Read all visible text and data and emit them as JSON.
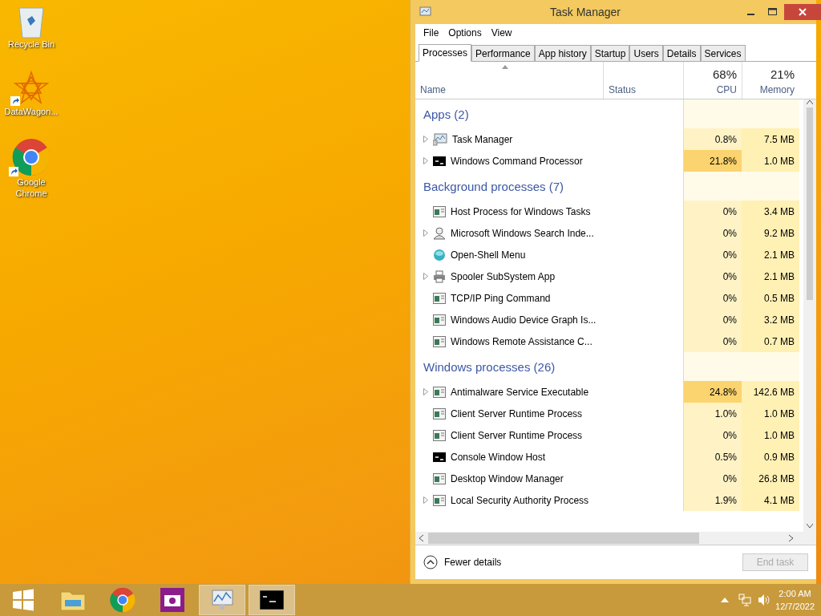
{
  "desktop": {
    "icons": [
      {
        "kind": "recycle",
        "label": "Recycle Bin",
        "shortcut": false
      },
      {
        "kind": "datawagon",
        "label": "DataWagon...",
        "shortcut": true
      },
      {
        "kind": "chrome",
        "label": "Google Chrome",
        "shortcut": true
      }
    ]
  },
  "window": {
    "title": "Task Manager",
    "menu": [
      "File",
      "Options",
      "View"
    ],
    "tabs": [
      {
        "label": "Processes",
        "selected": true
      },
      {
        "label": "Performance",
        "selected": false
      },
      {
        "label": "App history",
        "selected": false
      },
      {
        "label": "Startup",
        "selected": false
      },
      {
        "label": "Users",
        "selected": false
      },
      {
        "label": "Details",
        "selected": false
      },
      {
        "label": "Services",
        "selected": false
      }
    ],
    "columns": [
      {
        "label": "Name"
      },
      {
        "label": "Status"
      },
      {
        "label": "CPU",
        "total": "68%"
      },
      {
        "label": "Memory",
        "total": "21%"
      }
    ],
    "groups": [
      {
        "title": "Apps (2)",
        "processes": [
          {
            "kind": "taskmgr",
            "name": "Task Manager",
            "cpu": "0.8%",
            "memory": "7.5 MB",
            "expandable": true,
            "high": false
          },
          {
            "kind": "console",
            "name": "Windows Command Processor",
            "cpu": "21.8%",
            "memory": "1.0 MB",
            "expandable": true,
            "high": true
          }
        ]
      },
      {
        "title": "Background processes (7)",
        "processes": [
          {
            "kind": "service",
            "name": "Host Process for Windows Tasks",
            "cpu": "0%",
            "memory": "3.4 MB",
            "expandable": false,
            "high": false
          },
          {
            "kind": "search",
            "name": "Microsoft Windows Search Inde...",
            "cpu": "0%",
            "memory": "9.2 MB",
            "expandable": true,
            "high": false
          },
          {
            "kind": "shell",
            "name": "Open-Shell Menu",
            "cpu": "0%",
            "memory": "2.1 MB",
            "expandable": false,
            "high": false
          },
          {
            "kind": "printer",
            "name": "Spooler SubSystem App",
            "cpu": "0%",
            "memory": "2.1 MB",
            "expandable": true,
            "high": false
          },
          {
            "kind": "service",
            "name": "TCP/IP Ping Command",
            "cpu": "0%",
            "memory": "0.5 MB",
            "expandable": false,
            "high": false
          },
          {
            "kind": "service",
            "name": "Windows Audio Device Graph Is...",
            "cpu": "0%",
            "memory": "3.2 MB",
            "expandable": false,
            "high": false
          },
          {
            "kind": "service",
            "name": "Windows Remote Assistance C...",
            "cpu": "0%",
            "memory": "0.7 MB",
            "expandable": false,
            "high": false
          }
        ]
      },
      {
        "title": "Windows processes (26)",
        "processes": [
          {
            "kind": "service",
            "name": "Antimalware Service Executable",
            "cpu": "24.8%",
            "memory": "142.6 MB",
            "expandable": true,
            "high": true
          },
          {
            "kind": "service",
            "name": "Client Server Runtime Process",
            "cpu": "1.0%",
            "memory": "1.0 MB",
            "expandable": false,
            "high": false
          },
          {
            "kind": "service",
            "name": "Client Server Runtime Process",
            "cpu": "0%",
            "memory": "1.0 MB",
            "expandable": false,
            "high": false
          },
          {
            "kind": "console",
            "name": "Console Window Host",
            "cpu": "0.5%",
            "memory": "0.9 MB",
            "expandable": false,
            "high": false
          },
          {
            "kind": "service",
            "name": "Desktop Window Manager",
            "cpu": "0%",
            "memory": "26.8 MB",
            "expandable": false,
            "high": false
          },
          {
            "kind": "service",
            "name": "Local Security Authority Process",
            "cpu": "1.9%",
            "memory": "4.1 MB",
            "expandable": true,
            "high": false
          }
        ]
      }
    ],
    "fewer_details": "Fewer details",
    "end_task": {
      "label": "End task",
      "disabled": true
    }
  },
  "taskbar": {
    "items": [
      {
        "kind": "explorer",
        "open": false
      },
      {
        "kind": "chrome",
        "open": false
      },
      {
        "kind": "camera",
        "open": false
      },
      {
        "kind": "taskmgr",
        "open": true
      },
      {
        "kind": "console",
        "open": true
      }
    ],
    "time": "2:00 AM",
    "date": "12/7/2022"
  }
}
